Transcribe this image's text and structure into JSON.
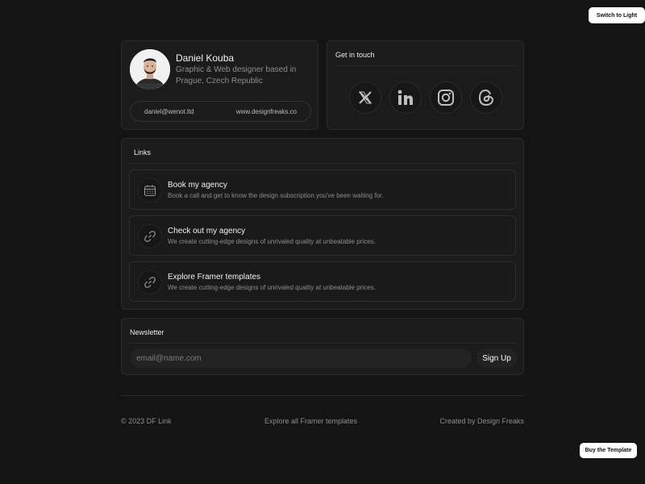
{
  "top_button": "Switch to Light",
  "profile": {
    "name": "Daniel Kouba",
    "bio_line1": "Graphic & Web designer based in",
    "bio_line2": "Prague, Czech Republic",
    "email": "daniel@wenot.ltd",
    "website": "www.designfreaks.co"
  },
  "get_in_touch": {
    "title": "Get in touch",
    "socials": [
      "x-icon",
      "linkedin-icon",
      "instagram-icon",
      "threads-icon"
    ]
  },
  "links": {
    "title": "Links",
    "items": [
      {
        "title": "Book my agency",
        "desc": "Book a call and get to know the design subscription you've been waiting for.",
        "icon": "calendar-icon"
      },
      {
        "title": "Check out my agency",
        "desc": "We create cutting-edge designs of unrivaled quality at unbeatable prices.",
        "icon": "link-icon"
      },
      {
        "title": "Explore Framer templates",
        "desc": "We create cutting-edge designs of unrivaled quality at unbeatable prices.",
        "icon": "link-icon"
      }
    ]
  },
  "newsletter": {
    "title": "Newsletter",
    "placeholder": "email@name.com",
    "button": "Sign Up"
  },
  "footer": {
    "copyright": "© 2023 DF Link",
    "explore": "Explore all Framer templates",
    "credit": "Created by Design Freaks"
  },
  "buy_button": "Buy the Template"
}
